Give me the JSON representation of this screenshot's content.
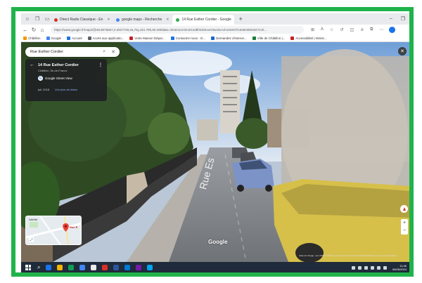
{
  "browser": {
    "tabs": [
      {
        "label": "Direct Radio Classique - En",
        "color": "#d93025",
        "active": false
      },
      {
        "label": "google maps - Recherche",
        "color": "#4285f4",
        "active": false
      },
      {
        "label": "14 Rue Esther Cordier - Google",
        "color": "#34a853",
        "active": true
      }
    ],
    "url": "https://www.google.fr/maps/@48.8075667,2.2927729,3a,75y,161.79h,80.29t/data=!3m6!1e1!3m4!1sd8hkJ8mu4V5x43vAd-w!2e0!7i16384!8i8192?coh...",
    "bookmarks": [
      {
        "label": "Châtillon",
        "color": "#f29900"
      },
      {
        "label": "Google",
        "color": "#4285f4"
      },
      {
        "label": "Accueil",
        "color": "#1a73e8"
      },
      {
        "label": "Accès aux applicatio...",
        "color": "#5f6368"
      },
      {
        "label": "Votre Maison Dépar...",
        "color": "#c5221f"
      },
      {
        "label": "Contactez-nous - D...",
        "color": "#1a73e8"
      },
      {
        "label": "Demandez d'interve...",
        "color": "#1967d2"
      },
      {
        "label": "Ville de Châtillon |...",
        "color": "#188038"
      },
      {
        "label": "Accessibilité | Minist...",
        "color": "#c5221f"
      }
    ]
  },
  "streetview": {
    "search_value": "Rue Esther Cordier",
    "card": {
      "title": "14 Rue Esther Cordier",
      "subtitle": "Châtillon, Île-de-France",
      "source": "Google Street View",
      "date": "juil. 2018",
      "more_dates": "Voir plus de dates"
    },
    "street_sign": "Rue Es",
    "watermark": "Google",
    "credits": "Date de l'image : juil. 2018    © 2024 Google    France    Conditions    Confidentialité    Envoyer des commentaires",
    "minimap_label": "Satellite",
    "minimap_place": "Rue E"
  },
  "taskbar": {
    "apps": [
      {
        "color": "#1a73e8"
      },
      {
        "color": "#f4b400"
      },
      {
        "color": "#0f9d58"
      },
      {
        "color": "#4285f4"
      },
      {
        "color": "#e8eaed"
      },
      {
        "color": "#d93025"
      },
      {
        "color": "#2b579a"
      },
      {
        "color": "#0078d4"
      },
      {
        "color": "#7719aa"
      },
      {
        "color": "#00a4ef"
      }
    ],
    "time": "11:46",
    "date": "06/06/2024"
  }
}
